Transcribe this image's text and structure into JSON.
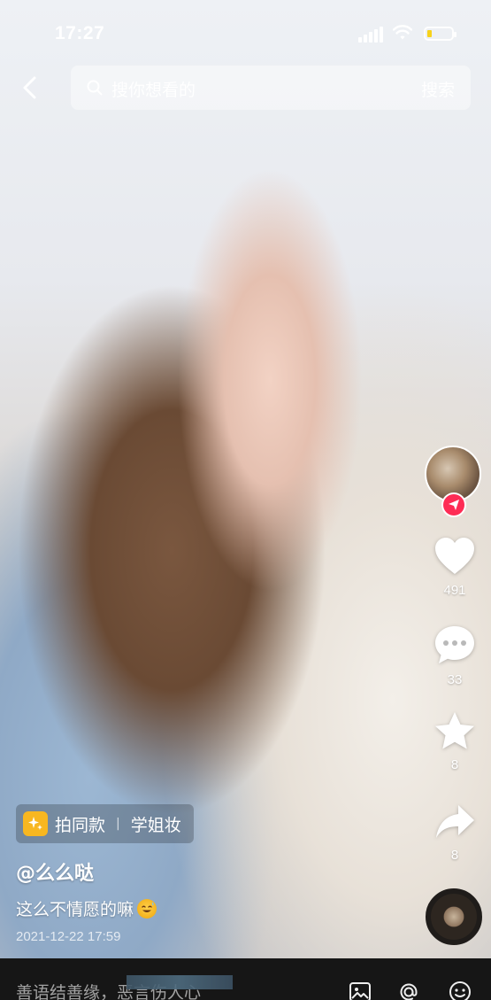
{
  "status_bar": {
    "time": "17:27"
  },
  "search": {
    "placeholder": "搜你想看的",
    "button_label": "搜索"
  },
  "actions": {
    "like_count": "491",
    "comment_count": "33",
    "favorite_count": "8",
    "share_count": "8"
  },
  "effect_tag": {
    "label": "拍同款",
    "name": "学姐妆"
  },
  "post": {
    "username": "@么么哒",
    "caption": "这么不情愿的嘛",
    "date": "2021-12-22 17:59"
  },
  "comment_bar": {
    "placeholder": "善语结善缘，恶言伤人心"
  },
  "colors": {
    "battery": "#f7d21b",
    "follow_badge": "#fe2c55",
    "effect_icon": "#f8b720"
  }
}
